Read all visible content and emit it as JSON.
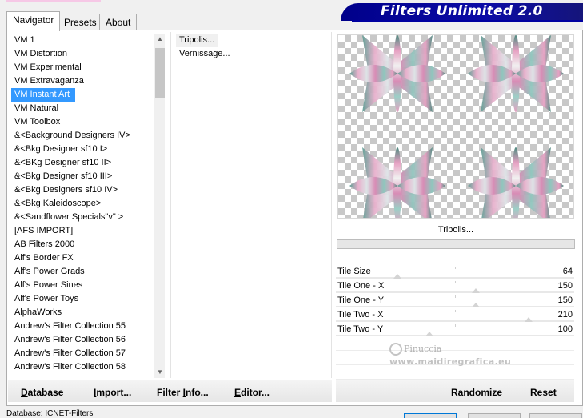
{
  "tabs": [
    {
      "label": "Navigator",
      "active": true
    },
    {
      "label": "Presets",
      "active": false
    },
    {
      "label": "About",
      "active": false
    }
  ],
  "banner": {
    "title": "Filters Unlimited 2.0"
  },
  "categories": [
    "VM 1",
    "VM Distortion",
    "VM Experimental",
    "VM Extravaganza",
    "VM Instant Art",
    "VM Natural",
    "VM Toolbox",
    "&<Background Designers IV>",
    "&<Bkg Designer sf10 I>",
    "&<BKg Designer sf10 II>",
    "&<Bkg Designer sf10 III>",
    "&<Bkg Designers sf10 IV>",
    "&<Bkg Kaleidoscope>",
    "&<Sandflower Specials\"v\" >",
    "[AFS IMPORT]",
    "AB Filters 2000",
    "Alf's Border FX",
    "Alf's Power Grads",
    "Alf's Power Sines",
    "Alf's Power Toys",
    "AlphaWorks",
    "Andrew's Filter Collection 55",
    "Andrew's Filter Collection 56",
    "Andrew's Filter Collection 57",
    "Andrew's Filter Collection 58"
  ],
  "selected_category": "VM Instant Art",
  "filters": [
    "Tripolis...",
    "Vernissage..."
  ],
  "selected_filter": "Tripolis...",
  "preview": {
    "filter_name": "Tripolis..."
  },
  "params": [
    {
      "name": "Tile Size",
      "value": "64",
      "level": 0.25
    },
    {
      "name": "Tile One - X",
      "value": "150",
      "level": 0.59
    },
    {
      "name": "Tile One - Y",
      "value": "150",
      "level": 0.59
    },
    {
      "name": "Tile Two - X",
      "value": "210",
      "level": 0.82
    },
    {
      "name": "Tile Two - Y",
      "value": "100",
      "level": 0.39
    }
  ],
  "watermark": {
    "name": "Pinuccia",
    "site": "www.maidiregrafica.eu"
  },
  "buttons_left": [
    {
      "pre": "",
      "u": "D",
      "post": "atabase"
    },
    {
      "pre": "",
      "u": "I",
      "post": "mport..."
    },
    {
      "pre": "Filter ",
      "u": "I",
      "post": "nfo..."
    },
    {
      "pre": "",
      "u": "E",
      "post": "ditor..."
    }
  ],
  "buttons_right": {
    "randomize": "Randomize",
    "reset": "Reset"
  },
  "status": {
    "text": "Database: ICNET-Filters"
  },
  "colors": {
    "selection": "#3399ff",
    "banner": "#00008a",
    "pink": "#e6a0c2",
    "teal": "#5f9e94"
  },
  "icons": [
    "scroll-up-arrow-icon",
    "scroll-down-arrow-icon",
    "pinuccia-watermark-icon"
  ]
}
